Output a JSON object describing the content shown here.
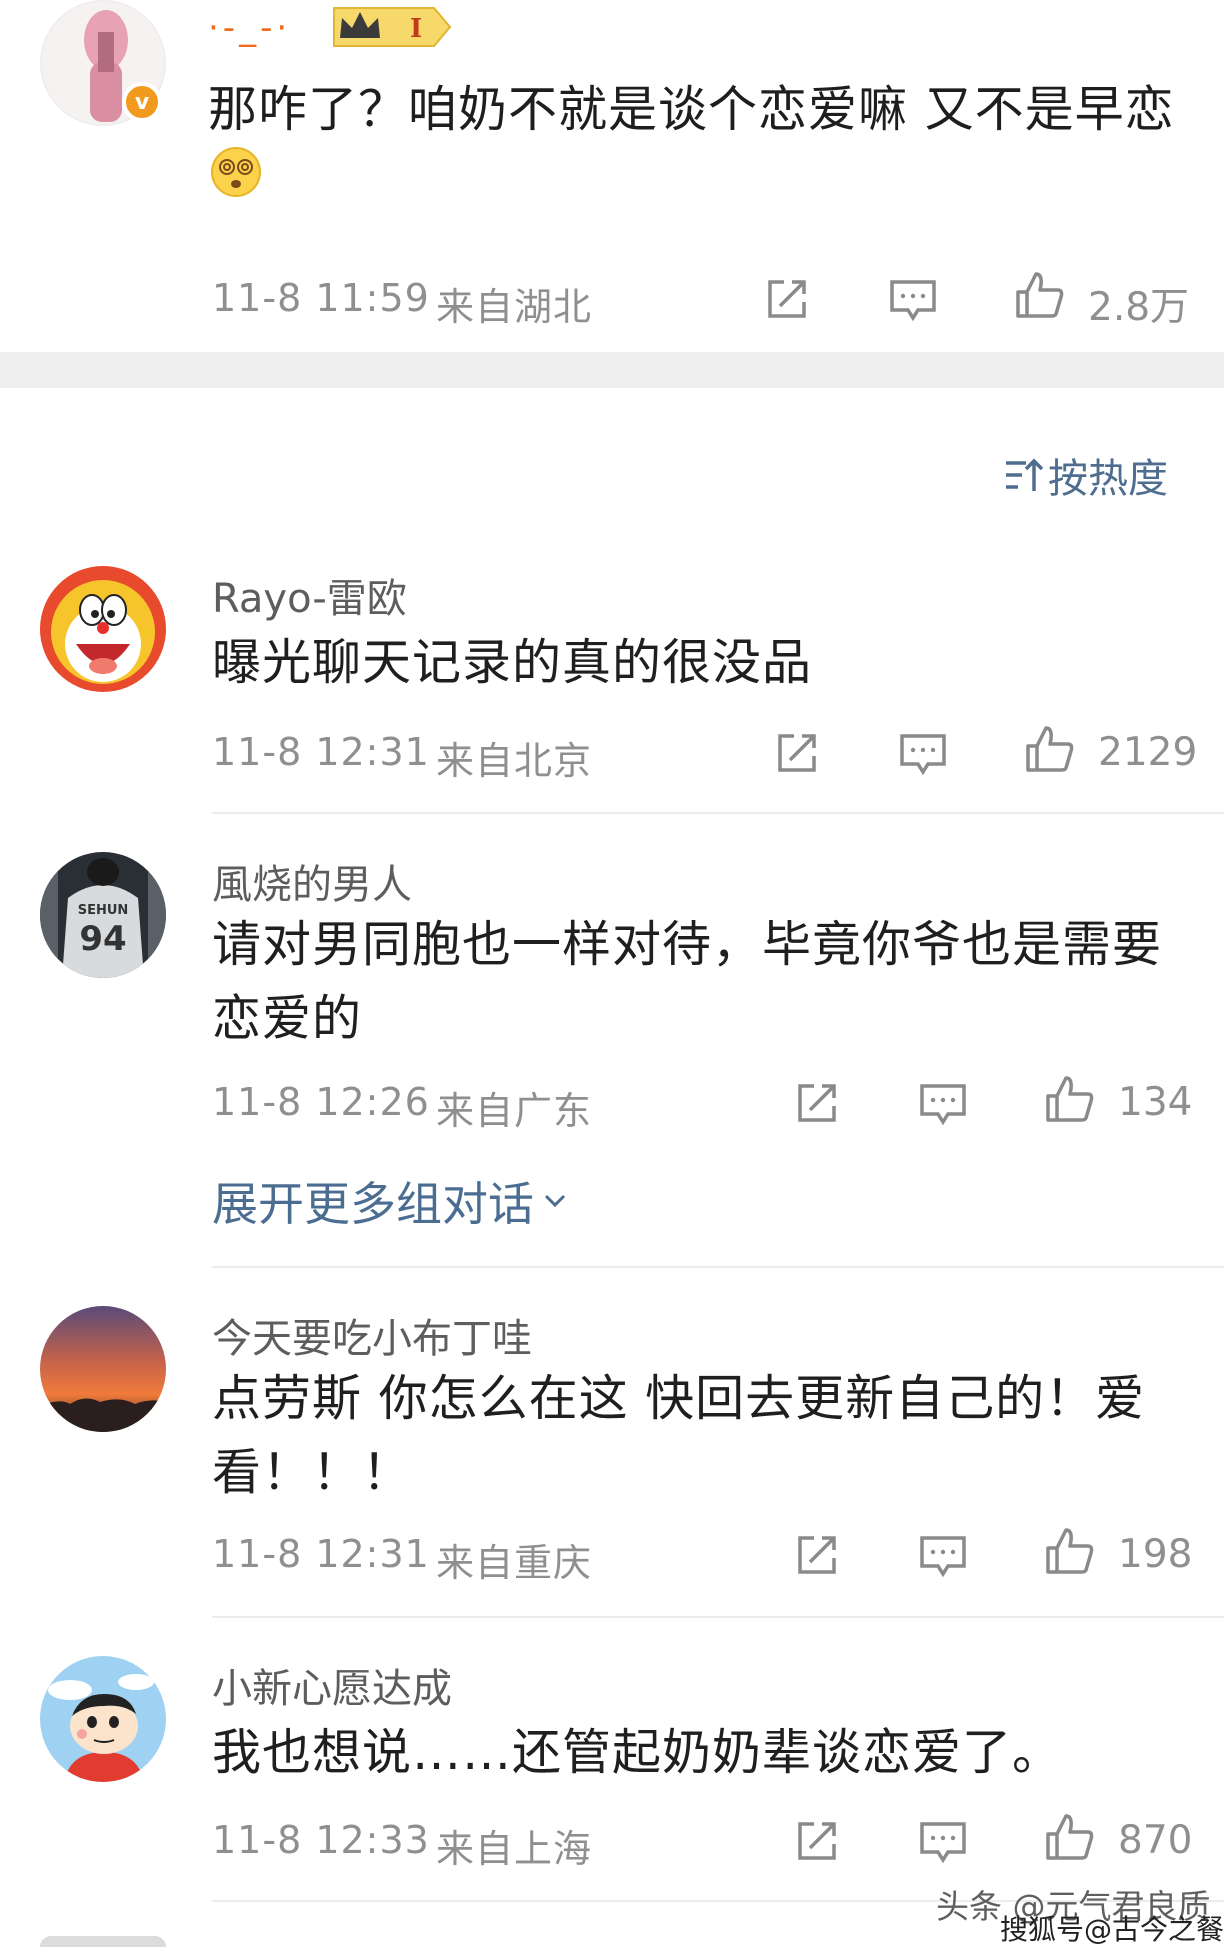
{
  "top_post": {
    "name": "·-_-·",
    "level": "I",
    "text": "那咋了？咱奶不就是谈个恋爱嘛 又不是早恋",
    "time": "11-8 11:59",
    "location": "来自湖北",
    "likes": "2.8万"
  },
  "sort_label": "按热度",
  "comments": [
    {
      "name": "Rayo-雷欧",
      "text": "曝光聊天记录的真的很没品",
      "time": "11-8 12:31",
      "location": "来自北京",
      "likes": "2129"
    },
    {
      "name": "風烧的男人",
      "text_line1": "请对男同胞也一样对待，毕竟你爷也是需要",
      "text_line2": "恋爱的",
      "time": "11-8 12:26",
      "location": "来自广东",
      "likes": "134",
      "jersey": "SEHUN 94"
    },
    {
      "name": "今天要吃小布丁哇",
      "text_line1": "点劳斯 你怎么在这 快回去更新自己的！爱",
      "text_line2": "看！！！",
      "time": "11-8 12:31",
      "location": "来自重庆",
      "likes": "198"
    },
    {
      "name": "小新心愿达成",
      "text": "我也想说……还管起奶奶辈谈恋爱了。",
      "time": "11-8 12:33",
      "location": "来自上海",
      "likes": "870"
    }
  ],
  "expand_label": "展开更多组对话",
  "watermark": {
    "line1": "头条 @元气君良质",
    "line2": "搜狐号@古今之餐"
  },
  "colors": {
    "link": "#4b6d91",
    "meta": "#8f8f8f",
    "band": "#eeeeee",
    "verified": "#f29a1d"
  }
}
